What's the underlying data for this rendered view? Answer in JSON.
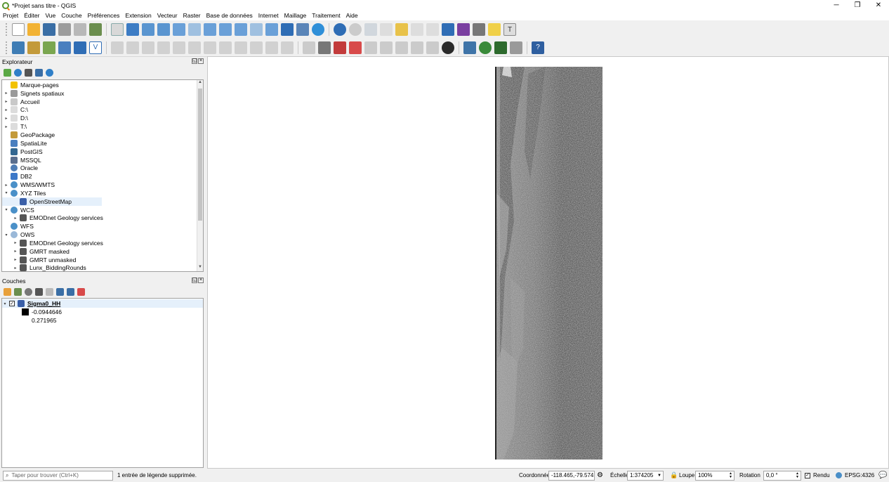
{
  "window": {
    "title": "*Projet sans titre - QGIS",
    "minimize": "─",
    "restore": "❐",
    "close": "✕"
  },
  "menu": [
    "Projet",
    "Éditer",
    "Vue",
    "Couche",
    "Préférences",
    "Extension",
    "Vecteur",
    "Raster",
    "Base de données",
    "Internet",
    "Maillage",
    "Traitement",
    "Aide"
  ],
  "browser": {
    "title": "Explorateur",
    "items": [
      {
        "label": "Marque-pages",
        "expander": "",
        "indent": 0,
        "icon": "star-icon",
        "color": "#f2c200"
      },
      {
        "label": "Signets spatiaux",
        "expander": "▸",
        "indent": 0,
        "icon": "bookmark-icon",
        "color": "#9a9a9a"
      },
      {
        "label": "Accueil",
        "expander": "▸",
        "indent": 0,
        "icon": "home-folder-icon",
        "color": "#c9c9c9"
      },
      {
        "label": "C:\\",
        "expander": "▸",
        "indent": 0,
        "icon": "folder-icon",
        "color": "#dcdcdc"
      },
      {
        "label": "D:\\",
        "expander": "▸",
        "indent": 0,
        "icon": "folder-icon",
        "color": "#dcdcdc"
      },
      {
        "label": "T:\\",
        "expander": "▸",
        "indent": 0,
        "icon": "folder-icon",
        "color": "#dcdcdc"
      },
      {
        "label": "GeoPackage",
        "expander": "",
        "indent": 0,
        "icon": "geopackage-icon",
        "color": "#c39a3a"
      },
      {
        "label": "SpatiaLite",
        "expander": "",
        "indent": 0,
        "icon": "spatialite-icon",
        "color": "#4a7fbf"
      },
      {
        "label": "PostGIS",
        "expander": "",
        "indent": 0,
        "icon": "postgis-icon",
        "color": "#336791"
      },
      {
        "label": "MSSQL",
        "expander": "",
        "indent": 0,
        "icon": "mssql-icon",
        "color": "#5a6e8e"
      },
      {
        "label": "Oracle",
        "expander": "",
        "indent": 0,
        "icon": "oracle-icon",
        "color": "#4f7db5"
      },
      {
        "label": "DB2",
        "expander": "",
        "indent": 0,
        "icon": "db2-icon",
        "color": "#3c78c8"
      },
      {
        "label": "WMS/WMTS",
        "expander": "▸",
        "indent": 0,
        "icon": "globe-icon",
        "color": "#4a90c8"
      },
      {
        "label": "XYZ Tiles",
        "expander": "▾",
        "indent": 0,
        "icon": "globe-icon",
        "color": "#4a90c8"
      },
      {
        "label": "OpenStreetMap",
        "expander": "",
        "indent": 1,
        "icon": "xyz-tile-icon",
        "color": "#3a5fa8",
        "selected": true
      },
      {
        "label": "WCS",
        "expander": "▾",
        "indent": 0,
        "icon": "globe-icon",
        "color": "#4a90c8"
      },
      {
        "label": "EMODnet Geology services",
        "expander": "▸",
        "indent": 1,
        "icon": "connection-icon",
        "color": "#555555"
      },
      {
        "label": "WFS",
        "expander": "",
        "indent": 0,
        "icon": "globe-icon",
        "color": "#4a90c8"
      },
      {
        "label": "OWS",
        "expander": "▾",
        "indent": 0,
        "icon": "globe-icon",
        "color": "#9ab8d8"
      },
      {
        "label": "EMODnet Geology services",
        "expander": "▸",
        "indent": 1,
        "icon": "connection-icon",
        "color": "#555555"
      },
      {
        "label": "GMRT masked",
        "expander": "▸",
        "indent": 1,
        "icon": "connection-icon",
        "color": "#555555"
      },
      {
        "label": "GMRT unmasked",
        "expander": "▸",
        "indent": 1,
        "icon": "connection-icon",
        "color": "#555555"
      },
      {
        "label": "Lunx_BiddingRounds",
        "expander": "▸",
        "indent": 1,
        "icon": "connection-icon",
        "color": "#555555"
      }
    ]
  },
  "layers": {
    "title": "Couches",
    "layer_name": "Sigma0_HH",
    "legend_min": "-0.0944646",
    "legend_max": "0.271965"
  },
  "status": {
    "search_placeholder": "Taper pour trouver (Ctrl+K)",
    "message": "1 entrée de légende supprimée.",
    "coord_label": "Coordonnée",
    "coord_value": "-118.465,-79.574",
    "scale_label": "Échelle",
    "scale_value": "1:374205",
    "magnifier_label": "Loupe",
    "magnifier_value": "100%",
    "rotation_label": "Rotation",
    "rotation_value": "0,0 °",
    "render_label": "Rendu",
    "crs": "EPSG:4326"
  },
  "colors": {
    "accent_green": "#589632",
    "accent_orange": "#ee7913",
    "raster_dark": "#5c5c5c"
  }
}
